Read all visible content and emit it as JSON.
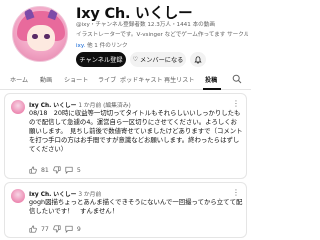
{
  "channel": {
    "name": "Ixy Ch. いくしー",
    "meta": "@ixy・チャンネル登録者数 12.3万人・1441 本の動画",
    "description": "イラストレーターです。Ⅴ-vsinger などでゲーム作ってます  サークル名 Endlicheri",
    "link_text": "ixy.",
    "link_extra": "他 1 件のリンク"
  },
  "buttons": {
    "subscribe": "チャンネル登録",
    "membership": "メンバーになる"
  },
  "tabs": [
    "ホーム",
    "動画",
    "ショート",
    "ライブ",
    "ポッドキャスト",
    "再生リスト",
    "投稿"
  ],
  "active_tab": "投稿",
  "posts": [
    {
      "author": "Ixy Ch. いくしー",
      "time": "1 か月前 (編集済み)",
      "text": "08/18　20時に収益等一切切ってタイトルもそれらしいいしっかりしたもので配信して急遽の4。運営自ら一区切りにさせてください。よろしくお願いします。　見ちし前後で数値寄せていましたけどありますで（コメントを打つ手口の方はお手間ですが意識などお願いします。終わったらはずしてください）",
      "likes": "81",
      "comments": "5"
    },
    {
      "author": "Ixy Ch. いくしー",
      "time": "3 か月前",
      "text": "gogh図描ちょっとあんま描くできそうにないんで一回撮ってから立てて配信したいです！　すんません！",
      "likes": "77",
      "comments": "9"
    }
  ]
}
